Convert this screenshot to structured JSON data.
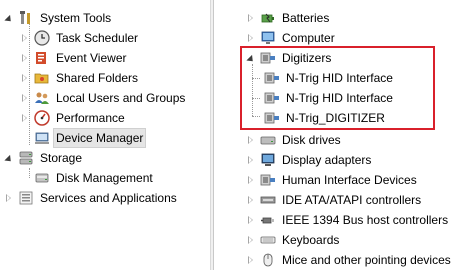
{
  "left_tree": [
    {
      "label": "System Tools",
      "icon": "tools-icon",
      "state": "expanded",
      "level": 1
    },
    {
      "label": "Task Scheduler",
      "icon": "clock-icon",
      "state": "collapsed",
      "level": 2
    },
    {
      "label": "Event Viewer",
      "icon": "event-viewer-icon",
      "state": "collapsed",
      "level": 2
    },
    {
      "label": "Shared Folders",
      "icon": "shared-folders-icon",
      "state": "collapsed",
      "level": 2
    },
    {
      "label": "Local Users and Groups",
      "icon": "users-icon",
      "state": "collapsed",
      "level": 2
    },
    {
      "label": "Performance",
      "icon": "performance-icon",
      "state": "collapsed",
      "level": 2
    },
    {
      "label": "Device Manager",
      "icon": "device-manager-icon",
      "state": "none",
      "level": 2,
      "selected": true
    },
    {
      "label": "Storage",
      "icon": "storage-icon",
      "state": "expanded",
      "level": 1
    },
    {
      "label": "Disk Management",
      "icon": "disk-management-icon",
      "state": "none",
      "level": 2
    },
    {
      "label": "Services and Applications",
      "icon": "services-icon",
      "state": "collapsed",
      "level": 1
    }
  ],
  "right_tree": [
    {
      "label": "Batteries",
      "icon": "battery-icon",
      "state": "collapsed",
      "level": 1
    },
    {
      "label": "Computer",
      "icon": "computer-icon",
      "state": "collapsed",
      "level": 1
    },
    {
      "label": "Digitizers",
      "icon": "hid-icon",
      "state": "expanded",
      "level": 1
    },
    {
      "label": "N-Trig HID Interface",
      "icon": "hid-icon",
      "state": "none",
      "level": 2
    },
    {
      "label": "N-Trig HID Interface",
      "icon": "hid-icon",
      "state": "none",
      "level": 2
    },
    {
      "label": "N-Trig_DIGITIZER",
      "icon": "hid-icon",
      "state": "none",
      "level": 2
    },
    {
      "label": "Disk drives",
      "icon": "disk-drive-icon",
      "state": "collapsed",
      "level": 1
    },
    {
      "label": "Display adapters",
      "icon": "monitor-icon",
      "state": "collapsed",
      "level": 1
    },
    {
      "label": "Human Interface Devices",
      "icon": "hid-icon",
      "state": "collapsed",
      "level": 1
    },
    {
      "label": "IDE ATA/ATAPI controllers",
      "icon": "ide-controller-icon",
      "state": "collapsed",
      "level": 1
    },
    {
      "label": "IEEE 1394 Bus host controllers",
      "icon": "ieee1394-icon",
      "state": "collapsed",
      "level": 1
    },
    {
      "label": "Keyboards",
      "icon": "keyboard-icon",
      "state": "collapsed",
      "level": 1
    },
    {
      "label": "Mice and other pointing devices",
      "icon": "mouse-icon",
      "state": "collapsed",
      "level": 1
    }
  ],
  "highlight_color": "#d9202b",
  "selection_color": "#e5e5e5"
}
